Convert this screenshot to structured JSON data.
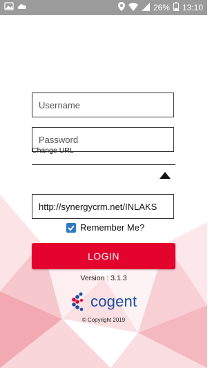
{
  "status_bar": {
    "battery": "26%",
    "time": "13:10",
    "icons": [
      "photo-icon",
      "cloud-icon",
      "location-icon",
      "wifi-icon",
      "signal-icon",
      "battery-icon"
    ]
  },
  "form": {
    "username_placeholder": "Username",
    "password_placeholder": "Password",
    "change_url_label": "Change URL",
    "url_value": "http://synergycrm.net/INLAKS",
    "remember_label": "Remember Me?",
    "remember_checked": true,
    "login_label": "LOGIN"
  },
  "footer": {
    "version": "Version : 3.1.3",
    "logo_text": "cogent",
    "copyright": "© Copyright 2019"
  },
  "colors": {
    "primary": "#e3032d",
    "logo_blue": "#1a4fa3",
    "status_bar": "#9b9b9b",
    "checkbox": "#2e7bc4"
  }
}
